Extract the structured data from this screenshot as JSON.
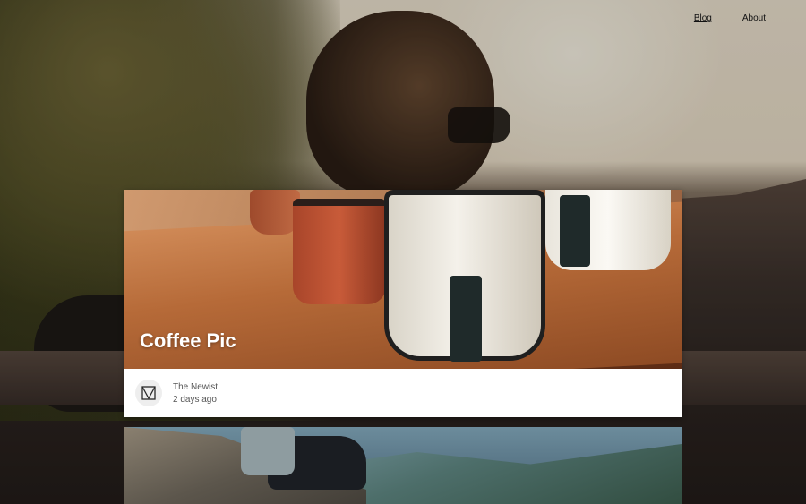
{
  "nav": {
    "items": [
      {
        "label": "Blog",
        "active": true
      },
      {
        "label": "About",
        "active": false
      }
    ]
  },
  "posts": [
    {
      "title": "Coffee Pic",
      "author": "The Newist",
      "date": "2 days ago",
      "avatar_icon": "newist-logo-icon"
    }
  ],
  "colors": {
    "card_background": "#ffffff",
    "meta_text": "#555555",
    "nav_text": "#111111"
  }
}
